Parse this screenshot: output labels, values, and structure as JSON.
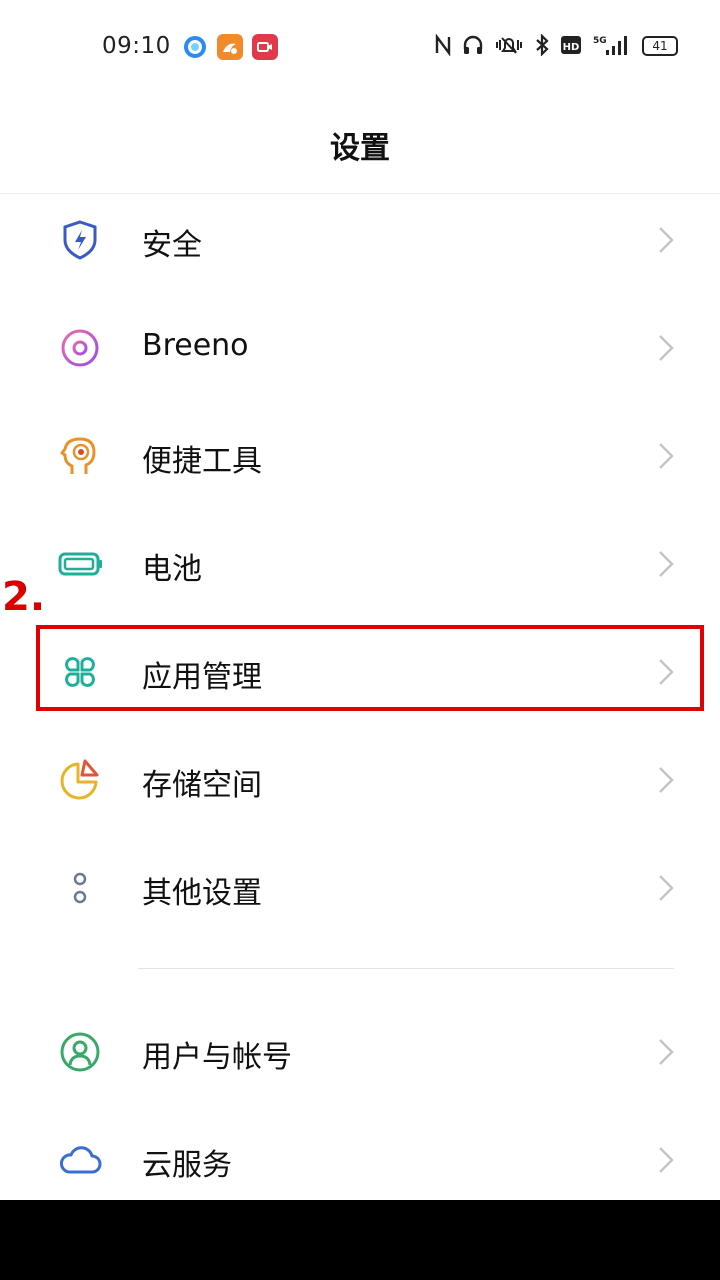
{
  "status_bar": {
    "time": "09:10",
    "battery": "41",
    "network": "5G",
    "hd_badge": "HD"
  },
  "page": {
    "title": "设置"
  },
  "settings_items": [
    {
      "label": "安全",
      "icon": "shield-bolt-icon",
      "color": "#3b5bc4"
    },
    {
      "label": "Breeno",
      "icon": "breeno-ring-icon",
      "color": "#c04fd6"
    },
    {
      "label": "便捷工具",
      "icon": "head-target-icon",
      "color": "#e8922a"
    },
    {
      "label": "电池",
      "icon": "battery-icon",
      "color": "#1fae9a"
    },
    {
      "label": "应用管理",
      "icon": "apps-grid-icon",
      "color": "#1fae9a"
    },
    {
      "label": "存储空间",
      "icon": "pie-chart-icon",
      "color": "#e6b32a"
    },
    {
      "label": "其他设置",
      "icon": "more-dots-icon",
      "color": "#6a7a90"
    },
    {
      "label": "用户与帐号",
      "icon": "user-account-icon",
      "color": "#3aa86a"
    },
    {
      "label": "云服务",
      "icon": "cloud-icon",
      "color": "#3b6ed1"
    }
  ],
  "annotation": {
    "step_label": "2.",
    "color": "#e10000"
  }
}
